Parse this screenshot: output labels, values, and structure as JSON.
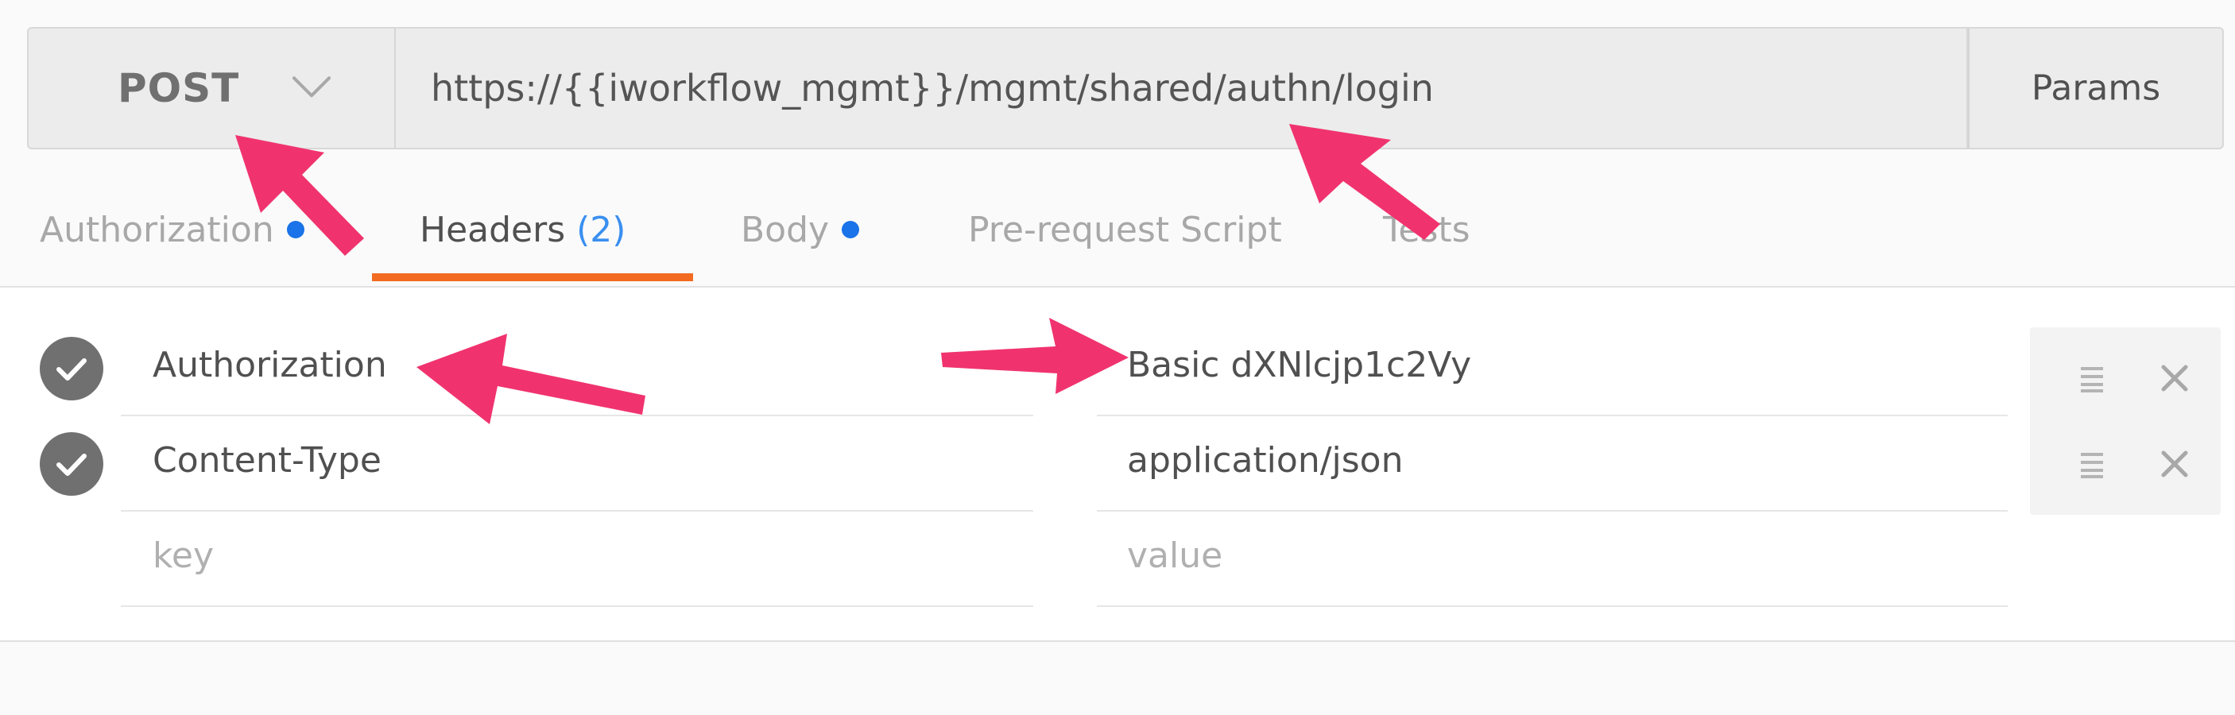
{
  "request": {
    "method": "POST",
    "url": "https://{{iworkflow_mgmt}}/mgmt/shared/authn/login",
    "params_label": "Params"
  },
  "tabs": {
    "authorization": "Authorization",
    "headers": "Headers",
    "headers_count": "(2)",
    "body": "Body",
    "prerequest": "Pre-request Script",
    "tests": "Tests"
  },
  "headers": {
    "rows": [
      {
        "key": "Authorization",
        "value": "Basic dXNlcjp1c2Vy"
      },
      {
        "key": "Content-Type",
        "value": "application/json"
      }
    ],
    "key_placeholder": "key",
    "value_placeholder": "value"
  },
  "colors": {
    "accent_underline": "#f26b21",
    "dot": "#1a73e8",
    "arrow": "#f0336e"
  },
  "icons": {
    "method_dropdown": "chevron-down-icon",
    "row_enabled": "check-circle-icon",
    "row_menu": "hamburger-icon",
    "row_remove": "close-icon"
  }
}
